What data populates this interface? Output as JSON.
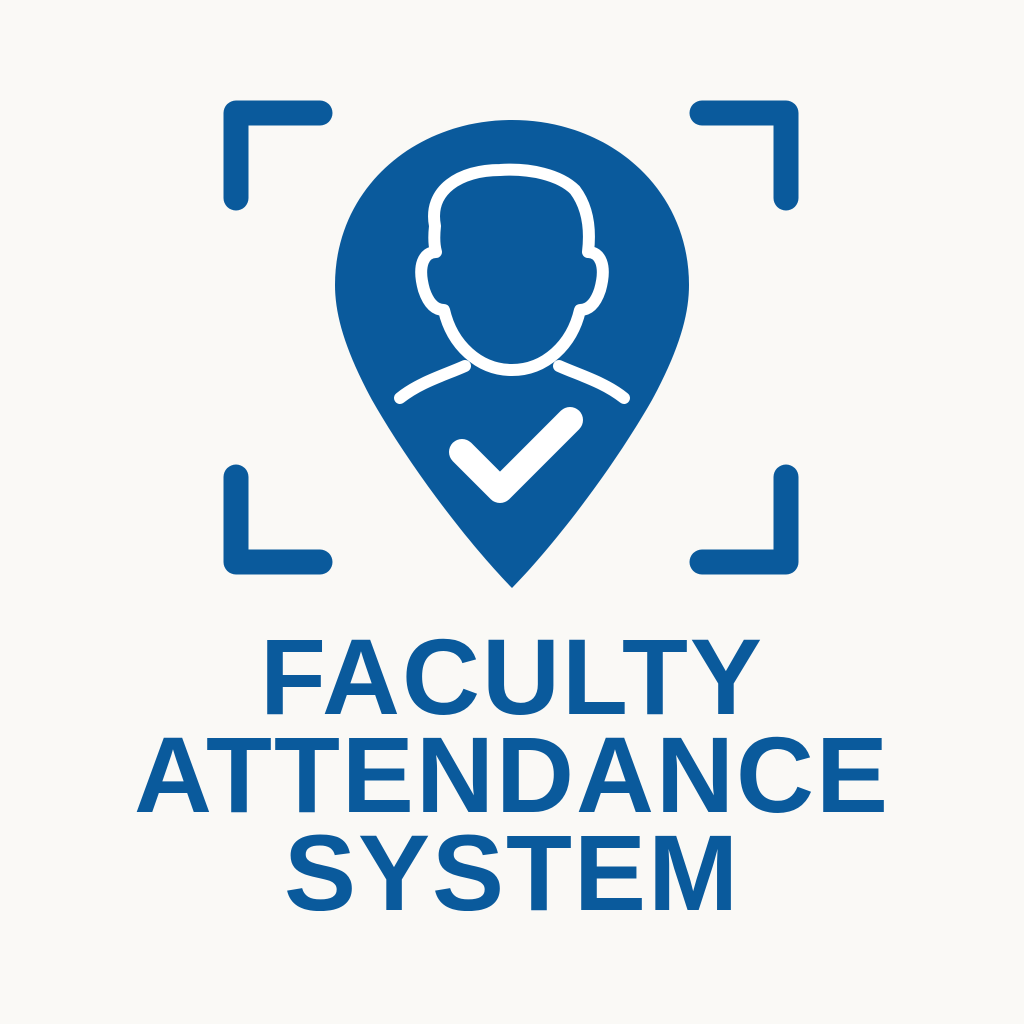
{
  "colors": {
    "brand_blue": "#0a5a9c",
    "background": "#faf9f6",
    "icon_white": "#ffffff"
  },
  "logo": {
    "icon_names": [
      "scan-frame-icon",
      "location-pin-icon",
      "person-icon",
      "checkmark-icon"
    ]
  },
  "title": {
    "line1": "FACULTY",
    "line2": "ATTENDANCE",
    "line3": "SYSTEM"
  }
}
